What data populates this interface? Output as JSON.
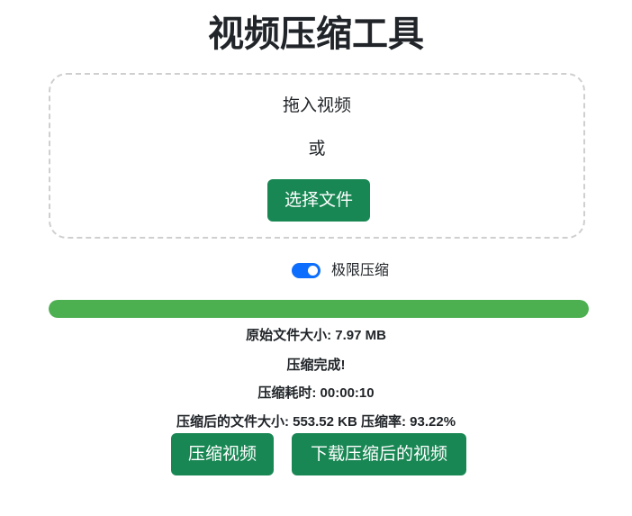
{
  "header": {
    "title": "视频压缩工具"
  },
  "upload": {
    "drop_text": "拖入视频",
    "or_text": "或",
    "select_label": "选择文件"
  },
  "options": {
    "extreme_label": "极限压缩",
    "extreme_enabled": true
  },
  "progress": {
    "percent": 100,
    "color": "#4caf50"
  },
  "results": {
    "original_size": "原始文件大小: 7.97 MB",
    "status": "压缩完成!",
    "elapsed": "压缩耗时: 00:00:10",
    "compressed_summary": "压缩后的文件大小: 553.52 KB 压缩率: 93.22%"
  },
  "actions": {
    "compress_label": "压缩视频",
    "download_label": "下载压缩后的视频"
  },
  "colors": {
    "primary_button": "#198754",
    "switch_on": "#0d6efd"
  }
}
